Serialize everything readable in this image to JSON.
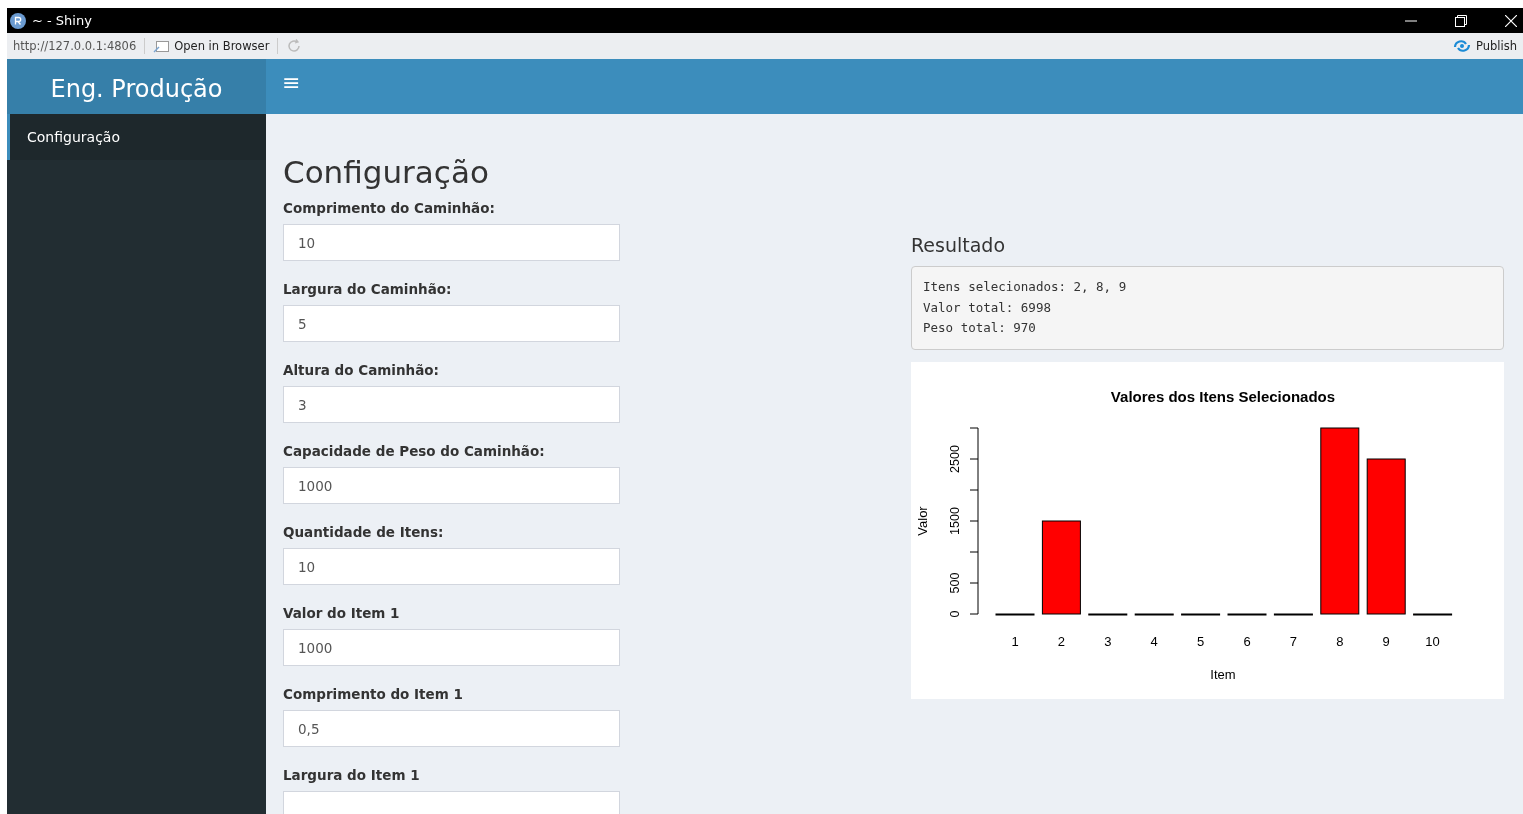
{
  "window": {
    "title": "~ - Shiny"
  },
  "toolbar": {
    "url": "http://127.0.0.1:4806",
    "open_in_browser": "Open in Browser",
    "publish": "Publish"
  },
  "sidebar": {
    "brand": "Eng. Produção",
    "items": [
      {
        "label": "Configuração",
        "selected": true
      }
    ]
  },
  "header": {
    "menu_glyph": "≡"
  },
  "page": {
    "title": "Configuração",
    "fields": [
      {
        "label": "Comprimento do Caminhão:",
        "value": "10"
      },
      {
        "label": "Largura do Caminhão:",
        "value": "5"
      },
      {
        "label": "Altura do Caminhão:",
        "value": "3"
      },
      {
        "label": "Capacidade de Peso do Caminhão:",
        "value": "1000"
      },
      {
        "label": "Quantidade de Itens:",
        "value": "10"
      },
      {
        "label": "Valor do Item 1",
        "value": "1000"
      },
      {
        "label": "Comprimento do Item 1",
        "value": "0,5"
      },
      {
        "label": "Largura do Item 1"
      }
    ]
  },
  "result": {
    "heading": "Resultado",
    "lines": [
      "Itens selecionados: 2, 8, 9",
      "Valor total: 6998",
      "Peso total: 970"
    ],
    "chart_data": {
      "type": "bar",
      "title": "Valores dos Itens Selecionados",
      "xlabel": "Item",
      "ylabel": "Valor",
      "categories": [
        "1",
        "2",
        "3",
        "4",
        "5",
        "6",
        "7",
        "8",
        "9",
        "10"
      ],
      "series": [
        {
          "color": "#ff0000",
          "values": [
            0,
            1500,
            0,
            0,
            0,
            0,
            0,
            3000,
            2500,
            0
          ]
        }
      ],
      "ylim": [
        0,
        3000
      ],
      "yticks": [
        0,
        500,
        1500,
        2500
      ]
    }
  }
}
